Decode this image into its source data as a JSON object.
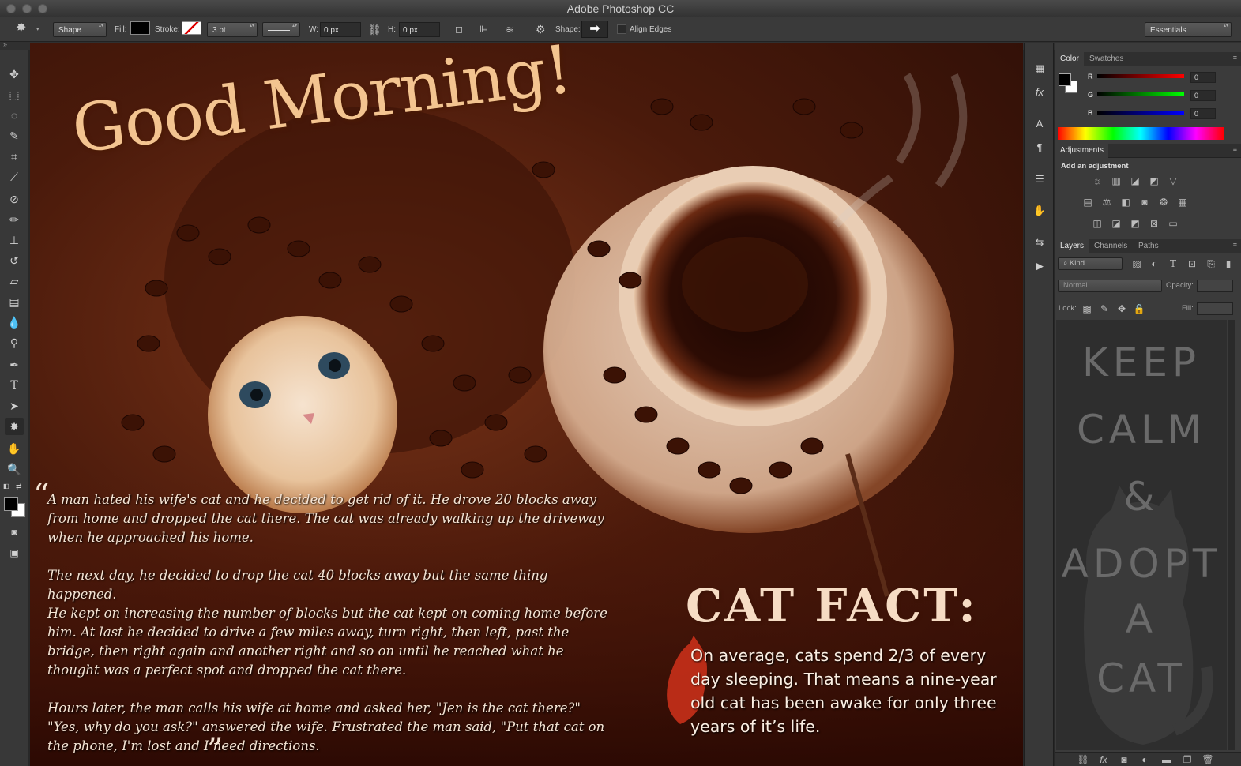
{
  "window": {
    "title": "Adobe Photoshop CC"
  },
  "options": {
    "mode": "Shape",
    "fill_label": "Fill:",
    "stroke_label": "Stroke:",
    "stroke_width": "3 pt",
    "w_label": "W:",
    "w_value": "0 px",
    "h_label": "H:",
    "h_value": "0 px",
    "shape_label": "Shape:",
    "align_edges": "Align Edges",
    "workspace": "Essentials"
  },
  "color_panel": {
    "tabs": [
      "Color",
      "Swatches"
    ],
    "channels": [
      {
        "label": "R",
        "value": "0"
      },
      {
        "label": "G",
        "value": "0"
      },
      {
        "label": "B",
        "value": "0"
      }
    ]
  },
  "adjustments": {
    "tab": "Adjustments",
    "hint": "Add an adjustment"
  },
  "layers_panel": {
    "tabs": [
      "Layers",
      "Channels",
      "Paths"
    ],
    "filter": "Kind",
    "blend_mode": "Normal",
    "opacity_label": "Opacity:",
    "lock_label": "Lock:",
    "fill_label": "Fill:",
    "preview_lines": [
      "KEEP",
      "CALM",
      "&",
      "ADOPT",
      "A",
      "CAT"
    ]
  },
  "canvas": {
    "headline": "Good Morning!",
    "story": [
      "A man hated his wife's cat and he decided to get rid of it. He drove 20 blocks away from home and dropped the cat there. The cat was already walking up the driveway when he approached his home.",
      "The next day, he decided to drop the cat 40 blocks away but the same thing happened.",
      "He kept on increasing the number of blocks but the cat kept on coming home before him. At last he decided to drive a few miles away, turn right, then left, past the bridge, then right again and another right and so on until he reached what he thought was a perfect spot and dropped the cat there.",
      "Hours later, the man calls his wife at home and asked her, \"Jen is the cat there?\" \"Yes, why do you ask?\" answered the wife. Frustrated the man said, \"Put that cat on the phone, I'm lost and I need directions."
    ],
    "catfact_title": "CAT FACT:",
    "catfact_text": "On average, cats spend 2/3 of every day sleeping. That means a  nine-year old cat has been awake for only three years of it’s life."
  }
}
